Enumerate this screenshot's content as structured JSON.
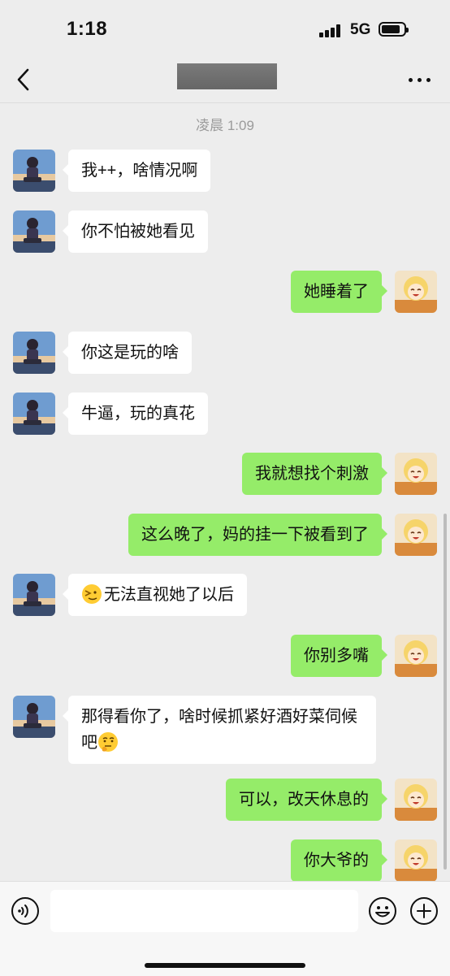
{
  "status_bar": {
    "time": "1:18",
    "network": "5G"
  },
  "nav": {
    "back_icon": "chevron-left-icon",
    "more_icon": "more-dots-icon"
  },
  "chat": {
    "timestamp": "凌晨 1:09",
    "messages": [
      {
        "side": "left",
        "text": "我++，啥情况啊"
      },
      {
        "side": "left",
        "text": "你不怕被她看见"
      },
      {
        "side": "right",
        "text": "她睡着了"
      },
      {
        "side": "left",
        "text": "你这是玩的啥"
      },
      {
        "side": "left",
        "text": "牛逼，玩的真花"
      },
      {
        "side": "right",
        "text": "我就想找个刺激"
      },
      {
        "side": "right",
        "text": "这么晚了，妈的挂一下被看到了"
      },
      {
        "side": "left",
        "text": "无法直视她了以后",
        "emoji": "facepalm-emoji"
      },
      {
        "side": "right",
        "text": "你别多嘴"
      },
      {
        "side": "left",
        "text": "那得看你了，啥时候抓紧好酒好菜伺候吧",
        "emoji": "thinking-emoji"
      },
      {
        "side": "right",
        "text": "可以，改天休息的"
      },
      {
        "side": "right",
        "text": "你大爷的"
      }
    ]
  },
  "input_bar": {
    "voice_icon": "voice-icon",
    "emoji_icon": "smile-icon",
    "plus_icon": "plus-icon"
  },
  "colors": {
    "background": "#ededed",
    "sent_bubble": "#95ec69",
    "received_bubble": "#ffffff"
  }
}
